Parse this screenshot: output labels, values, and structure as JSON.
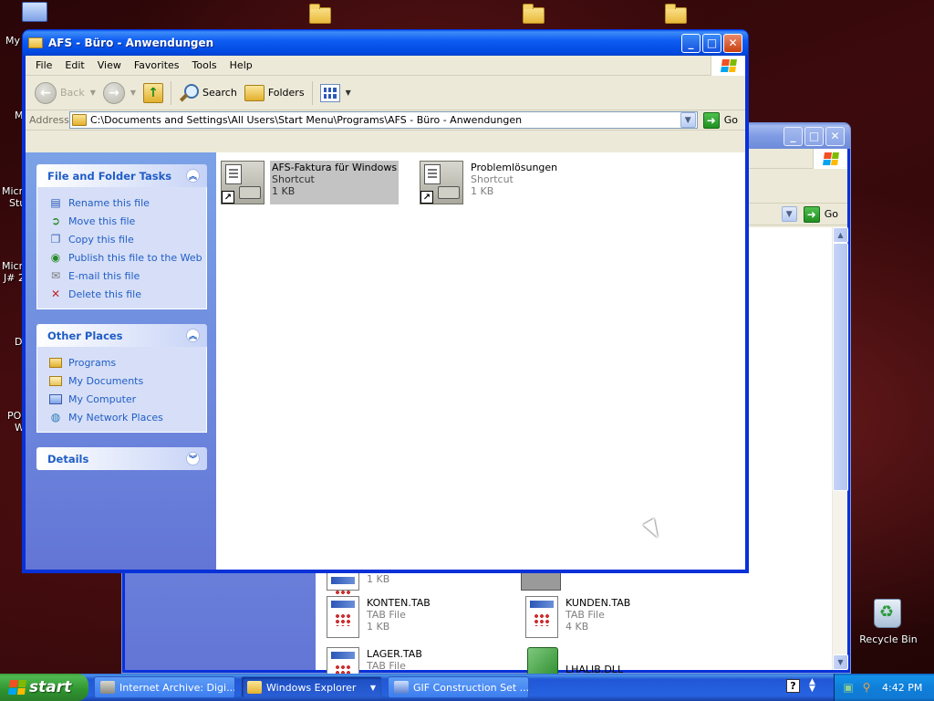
{
  "desktop": {
    "icons": [
      {
        "label": "My"
      },
      {
        "label": "M"
      },
      {
        "label": "Micr"
      },
      {
        "label": "Stu"
      },
      {
        "label": "Micr"
      },
      {
        "label": "J# 2"
      },
      {
        "label": "D"
      },
      {
        "label": "PO"
      },
      {
        "label": "W"
      }
    ],
    "recycle_bin": "Recycle Bin"
  },
  "back_window": {
    "go_label": "Go",
    "files": [
      {
        "name": "",
        "type": "",
        "size": "1 KB"
      },
      {
        "name": "KONTEN.TAB",
        "type": "TAB File",
        "size": "1 KB"
      },
      {
        "name": "KUNDEN.TAB",
        "type": "TAB File",
        "size": "4 KB"
      },
      {
        "name": "LAGER.TAB",
        "type": "TAB File",
        "size": ""
      },
      {
        "name": "LHALIB.DLL",
        "type": "",
        "size": ""
      }
    ]
  },
  "window": {
    "title": "AFS - Büro - Anwendungen",
    "menu": [
      "File",
      "Edit",
      "View",
      "Favorites",
      "Tools",
      "Help"
    ],
    "toolbar": {
      "back": "Back",
      "search": "Search",
      "folders": "Folders"
    },
    "address": {
      "label": "Address",
      "value": "C:\\Documents and Settings\\All Users\\Start Menu\\Programs\\AFS - Büro - Anwendungen",
      "go": "Go"
    },
    "task_pane": {
      "file_tasks": {
        "title": "File and Folder Tasks",
        "items": [
          {
            "label": "Rename this file",
            "icon": "rename-icon"
          },
          {
            "label": "Move this file",
            "icon": "move-icon"
          },
          {
            "label": "Copy this file",
            "icon": "copy-icon"
          },
          {
            "label": "Publish this file to the Web",
            "icon": "globe-icon"
          },
          {
            "label": "E-mail this file",
            "icon": "email-icon"
          },
          {
            "label": "Delete this file",
            "icon": "delete-icon"
          }
        ]
      },
      "other_places": {
        "title": "Other Places",
        "items": [
          {
            "label": "Programs",
            "icon": "folder-icon"
          },
          {
            "label": "My Documents",
            "icon": "documents-icon"
          },
          {
            "label": "My Computer",
            "icon": "computer-icon"
          },
          {
            "label": "My Network Places",
            "icon": "network-icon"
          }
        ]
      },
      "details": {
        "title": "Details"
      }
    },
    "files": [
      {
        "name": "AFS-Faktura für Windows",
        "type": "Shortcut",
        "size": "1 KB",
        "selected": true
      },
      {
        "name": "Problemlösungen",
        "type": "Shortcut",
        "size": "1 KB",
        "selected": false
      }
    ]
  },
  "taskbar": {
    "start": "start",
    "buttons": [
      {
        "label": "Internet Archive: Digi...",
        "active": false
      },
      {
        "label": "Windows Explorer",
        "active": true
      },
      {
        "label": "GIF Construction Set ...",
        "active": false
      }
    ],
    "clock": "4:42 PM"
  }
}
